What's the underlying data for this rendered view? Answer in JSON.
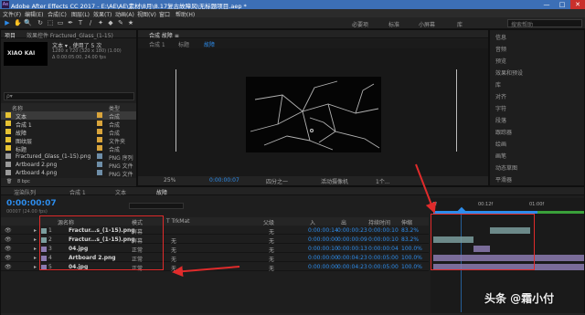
{
  "app": {
    "title": "Adobe After Effects CC 2017 - E:\\AE\\AE\\素材\\8月\\8.17复古故障风\\无标题项目.aep *",
    "logo": "Ae"
  },
  "window_controls": [
    "—",
    "□",
    "✕"
  ],
  "menu": [
    "文件(F)",
    "编辑(E)",
    "合成(C)",
    "图层(L)",
    "效果(T)",
    "动画(A)",
    "视图(V)",
    "窗口",
    "帮助(H)"
  ],
  "tools": [
    "▶",
    "✋",
    "🔍",
    "↻",
    "⬚",
    "▭",
    "✒",
    "T",
    "/",
    "✦",
    "◆",
    "✎",
    "★"
  ],
  "workspaces": {
    "items": [
      "必要项",
      "标准",
      "小屏幕",
      "库"
    ],
    "search_placeholder": "搜索帮助"
  },
  "project_panel": {
    "tabs": [
      "项目",
      "效果控件 Fractured_Glass_(1-15)"
    ],
    "thumb_text": "XIAO KAI",
    "selected_name": "文本 ▾ , 使用了 5 次",
    "selected_info1": "1280 x 720 (320 x 180) (1.00)",
    "selected_info2": "Δ 0:00:05:00, 24.00 fps",
    "search_placeholder": "ρ▾",
    "headers": [
      "名称",
      "类型"
    ],
    "items": [
      {
        "name": "文本",
        "type": "合成",
        "color": "#e6c233",
        "selected": true
      },
      {
        "name": "合成 1",
        "type": "合成",
        "color": "#e6c233",
        "selected": false
      },
      {
        "name": "故障",
        "type": "合成",
        "color": "#e6c233",
        "selected": false
      },
      {
        "name": "图纹层",
        "type": "文件夹",
        "color": "#e6c233",
        "selected": false
      },
      {
        "name": "标题",
        "type": "合成",
        "color": "#e6c233",
        "selected": false
      },
      {
        "name": "Fractured_Glass_(1-15).png",
        "type": "PNG 序列",
        "color": "#9a9a9a",
        "selected": false
      },
      {
        "name": "Artboard 2.png",
        "type": "PNG 文件",
        "color": "#9a9a9a",
        "selected": false
      },
      {
        "name": "Artboard 4.png",
        "type": "PNG 文件",
        "color": "#9a9a9a",
        "selected": false
      }
    ],
    "bpc": "8 bpc"
  },
  "composition_panel": {
    "tab": "合成 故障 ≡",
    "breadcrumb": [
      "合成 1",
      "标题",
      "故障"
    ],
    "bottom": {
      "zoom": "25%",
      "time": "0:00:00:07",
      "resolution": "四分之一",
      "camera": "活动摄像机",
      "views": "1个..."
    }
  },
  "right_panel": {
    "items": [
      "信息",
      "音频",
      "预览",
      "效果和预设",
      "库",
      "对齐",
      "字符",
      "段落",
      "跟踪器",
      "绘画",
      "画笔",
      "动态草图",
      "平滑器"
    ]
  },
  "timeline": {
    "tabs": [
      "渲染队列",
      "合成 1",
      "文本",
      "故障"
    ],
    "timecode": "0:00:00:07",
    "fps": "00007 (24.00 fps)",
    "headers": {
      "name": "源名称",
      "mode": "模式",
      "trkmat": "T TrkMat",
      "parent": "父级",
      "in": "入",
      "out": "出",
      "duration": "持续时间",
      "stretch": "伸缩"
    },
    "ruler": [
      "0f",
      "00:12f",
      "01:00f"
    ],
    "layers": [
      {
        "num": "1",
        "name": "Fractur...s_(1-15).png",
        "mode": "屏幕",
        "trkmat": "",
        "parent": "无",
        "in": "0:00:00:14",
        "out": "0:00:00:23",
        "dur": "0:00:00:10",
        "stretch": "83.2%",
        "color": "#7b9e9e"
      },
      {
        "num": "2",
        "name": "Fractur...s_(1-15).png",
        "mode": "屏幕",
        "trkmat": "无",
        "parent": "无",
        "in": "0:00:00:00",
        "out": "0:00:00:09",
        "dur": "0:00:00:10",
        "stretch": "83.2%",
        "color": "#7b9e9e"
      },
      {
        "num": "3",
        "name": "04.jpg",
        "mode": "正常",
        "trkmat": "无",
        "parent": "无",
        "in": "0:00:00:10",
        "out": "0:00:00:13",
        "dur": "0:00:00:04",
        "stretch": "100.0%",
        "color": "#8c7bb0"
      },
      {
        "num": "4",
        "name": "Artboard 2.png",
        "mode": "正常",
        "trkmat": "无",
        "parent": "无",
        "in": "0:00:00:00",
        "out": "0:00:04:23",
        "dur": "0:00:05:00",
        "stretch": "100.0%",
        "color": "#8c7bb0"
      },
      {
        "num": "5",
        "name": "04.jpg",
        "mode": "正常",
        "trkmat": "无",
        "parent": "无",
        "in": "0:00:00:00",
        "out": "0:00:04:23",
        "dur": "0:00:05:00",
        "stretch": "100.0%",
        "color": "#8c7bb0"
      }
    ]
  },
  "watermark": "头条 @霜小付",
  "colors": {
    "accent": "#2d8ceb",
    "title_bar": "#3c6fb6",
    "annotation": "#e02b2b"
  }
}
